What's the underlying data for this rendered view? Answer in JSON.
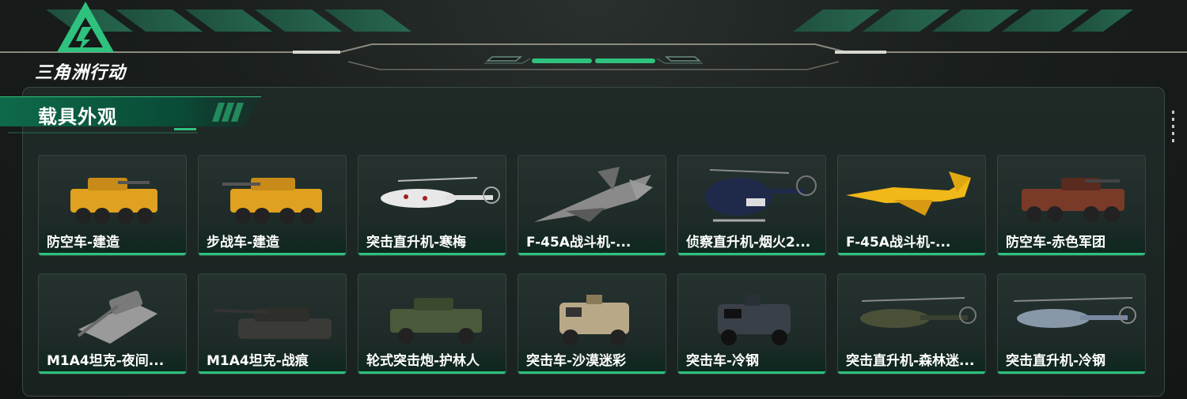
{
  "brand": {
    "logo_text": "三角洲行动",
    "accent": "#2ec27e"
  },
  "section": {
    "title": "载具外观"
  },
  "cards": [
    {
      "label": "防空车-建造",
      "icon": "apc-wheeled-icon",
      "color": "#e0a020"
    },
    {
      "label": "步战车-建造",
      "icon": "apc-wheeled-icon",
      "color": "#e0a020"
    },
    {
      "label": "突击直升机-寒梅",
      "icon": "helicopter-icon",
      "color": "#e8e8e8"
    },
    {
      "label": "F-45A战斗机-...",
      "icon": "jet-icon",
      "color": "#8a8a8a"
    },
    {
      "label": "侦察直升机-烟火2...",
      "icon": "scout-helicopter-icon",
      "color": "#1f2a4a"
    },
    {
      "label": "F-45A战斗机-...",
      "icon": "jet-icon",
      "color": "#f0b818"
    },
    {
      "label": "防空车-赤色军团",
      "icon": "apc-wheeled-icon",
      "color": "#7a3a28"
    },
    {
      "label": "M1A4坦克-夜间...",
      "icon": "tank-icon",
      "color": "#9a9a9a"
    },
    {
      "label": "M1A4坦克-战痕",
      "icon": "tank-icon",
      "color": "#3a3a36"
    },
    {
      "label": "轮式突击炮-护林人",
      "icon": "armored-car-icon",
      "color": "#4a5a3a"
    },
    {
      "label": "突击车-沙漠迷彩",
      "icon": "armored-car-icon",
      "color": "#b8a888"
    },
    {
      "label": "突击车-冷钢",
      "icon": "armored-car-icon",
      "color": "#3a4048"
    },
    {
      "label": "突击直升机-森林迷...",
      "icon": "helicopter-icon",
      "color": "#4a5038"
    },
    {
      "label": "突击直升机-冷钢",
      "icon": "helicopter-icon",
      "color": "#8898a8"
    }
  ]
}
